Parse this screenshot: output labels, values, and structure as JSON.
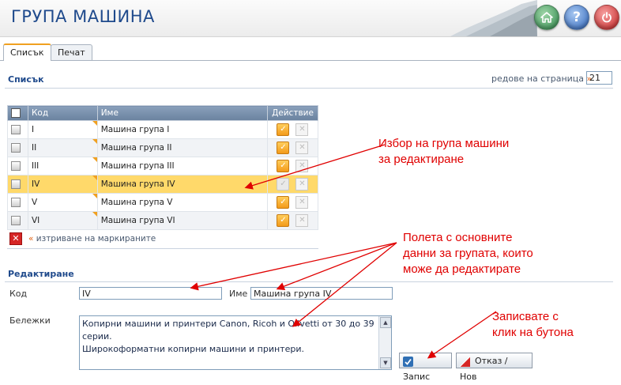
{
  "header": {
    "title": "ГРУПА МАШИНА",
    "icons": [
      "home-icon",
      "help-icon",
      "power-icon"
    ],
    "help_glyph": "?"
  },
  "tabs": [
    {
      "label": "Списък",
      "active": true
    },
    {
      "label": "Печат",
      "active": false
    }
  ],
  "list": {
    "section_title": "Списък",
    "rows_per_page_label": "редове на страница",
    "rows_per_page_arrow": "»",
    "rows_per_page_value": "21",
    "columns": {
      "code": "Код",
      "name": "Име",
      "action": "Действие"
    },
    "rows": [
      {
        "code": "I",
        "name": "Машина група I",
        "selected": false
      },
      {
        "code": "II",
        "name": "Машина група II",
        "selected": false
      },
      {
        "code": "III",
        "name": "Машина група III",
        "selected": false
      },
      {
        "code": "IV",
        "name": "Машина група IV",
        "selected": true
      },
      {
        "code": "V",
        "name": "Машина група V",
        "selected": false
      },
      {
        "code": "VI",
        "name": "Машина група VI",
        "selected": false
      }
    ],
    "delete_marked_arrow": "«",
    "delete_marked_label": "изтриване на маркираните"
  },
  "edit": {
    "section_title": "Редактиране",
    "code_label": "Код",
    "code_value": "IV",
    "name_label": "Име",
    "name_value": "Машина група IV",
    "notes_label": "Бележки",
    "notes_line1": "Копирни машини и принтери Canon, Ricoh и Olivetti от 30 до 39 серии.",
    "notes_line2": "Широкоформатни копирни машини и принтери.",
    "save_label": "Запис",
    "cancel_label": "Отказ / Нов"
  },
  "annotations": {
    "select_group": [
      "Избор на група машини",
      "за редактиране"
    ],
    "fields": [
      "Полета с основните",
      "данни за групата, които",
      "може да редактирате"
    ],
    "save": [
      "Записвате с",
      "клик на бутона"
    ]
  },
  "colors": {
    "title_blue": "#1f4a8c",
    "selected_row": "#ffd96a",
    "annotation_red": "#e00000",
    "accent_orange": "#f0a020"
  }
}
